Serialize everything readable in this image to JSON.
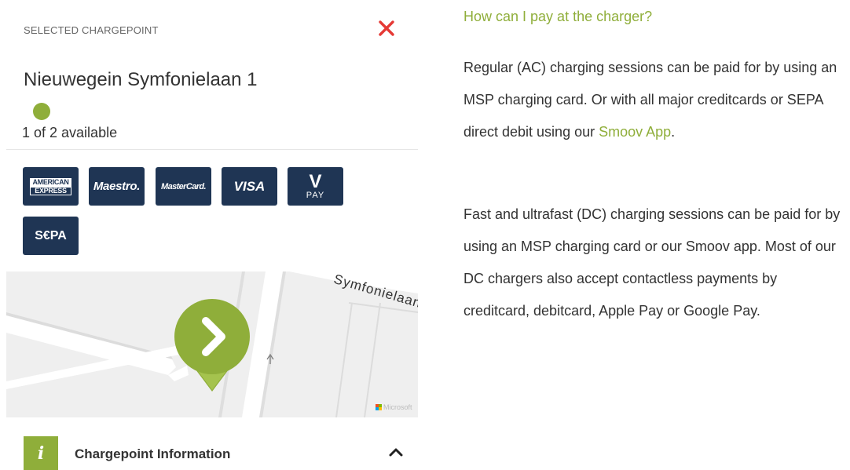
{
  "panel": {
    "selected_label": "SELECTED CHARGEPOINT",
    "chargepoint_name": "Nieuwegein Symfonielaan 1",
    "availability": "1 of 2 available",
    "status_color": "#8fae3a",
    "payment_methods": [
      {
        "name": "american-express",
        "line1": "AMERICAN",
        "line2": "EXPRESS"
      },
      {
        "name": "maestro",
        "label": "Maestro."
      },
      {
        "name": "mastercard",
        "label": "MasterCard."
      },
      {
        "name": "visa",
        "label": "VISA"
      },
      {
        "name": "vpay",
        "label": "V",
        "sub": "PAY"
      },
      {
        "name": "sepa",
        "label": "S€PA"
      }
    ]
  },
  "map": {
    "street_label": "Symfonielaan",
    "attribution": "Microsoft"
  },
  "info_section": {
    "icon_letter": "i",
    "title": "Chargepoint Information"
  },
  "faq": {
    "question": "How can I pay at the charger?",
    "p1_before": "Regular (AC) charging sessions can be paid for by using an MSP charging card. Or with all major creditcards or SEPA direct debit using our ",
    "p1_link": "Smoov App",
    "p1_after": ".",
    "p2": "Fast and ultrafast (DC) charging sessions can be paid for by using an MSP charging card or our Smoov app. Most of our DC chargers also accept contactless payments by creditcard, debitcard, Apple Pay or Google Pay."
  },
  "colors": {
    "accent_green": "#8fae3a",
    "card_navy": "#1f3554",
    "close_red": "#e53935"
  }
}
